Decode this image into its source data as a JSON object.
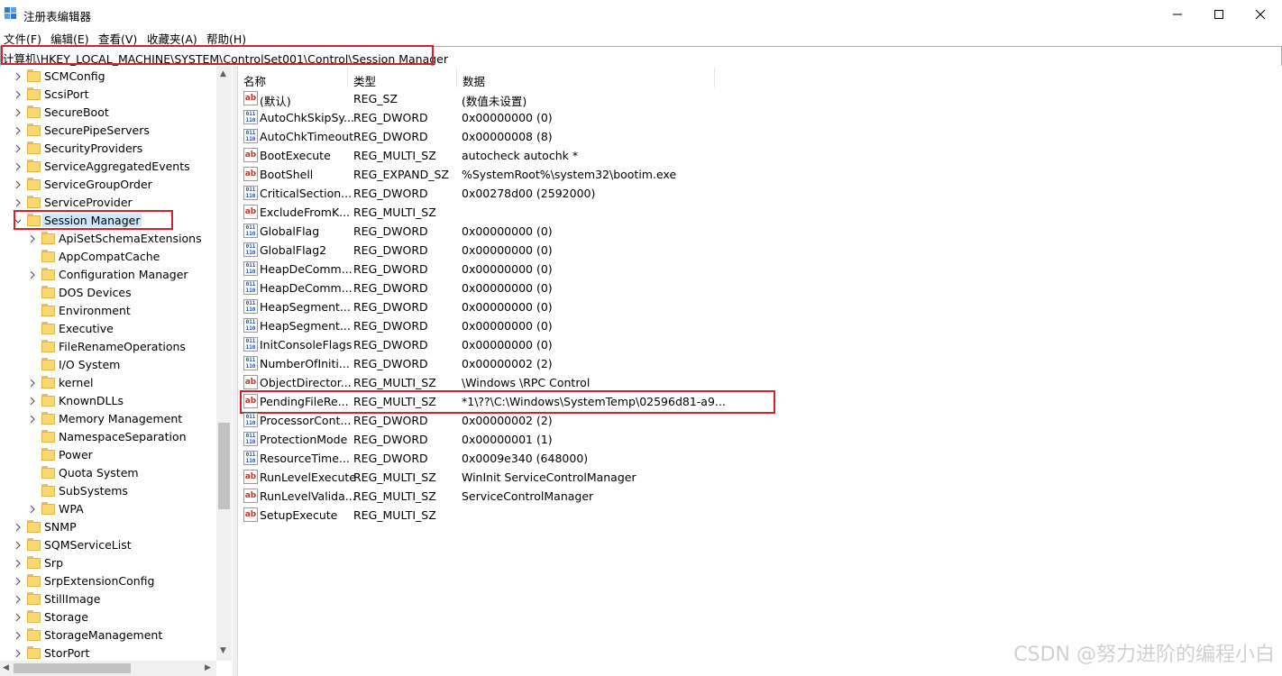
{
  "window": {
    "title": "注册表编辑器"
  },
  "menu": [
    "文件(F)",
    "编辑(E)",
    "查看(V)",
    "收藏夹(A)",
    "帮助(H)"
  ],
  "address": "计算机\\HKEY_LOCAL_MACHINE\\SYSTEM\\ControlSet001\\Control\\Session Manager",
  "tree": [
    {
      "label": "SCMConfig",
      "level": 0,
      "expandable": true
    },
    {
      "label": "ScsiPort",
      "level": 0,
      "expandable": true
    },
    {
      "label": "SecureBoot",
      "level": 0,
      "expandable": true
    },
    {
      "label": "SecurePipeServers",
      "level": 0,
      "expandable": true
    },
    {
      "label": "SecurityProviders",
      "level": 0,
      "expandable": true
    },
    {
      "label": "ServiceAggregatedEvents",
      "level": 0,
      "expandable": true
    },
    {
      "label": "ServiceGroupOrder",
      "level": 0,
      "expandable": true
    },
    {
      "label": "ServiceProvider",
      "level": 0,
      "expandable": true
    },
    {
      "label": "Session Manager",
      "level": 0,
      "expandable": true,
      "expanded": true,
      "selected": true
    },
    {
      "label": "ApiSetSchemaExtensions",
      "level": 1,
      "expandable": true
    },
    {
      "label": "AppCompatCache",
      "level": 1,
      "expandable": false
    },
    {
      "label": "Configuration Manager",
      "level": 1,
      "expandable": true
    },
    {
      "label": "DOS Devices",
      "level": 1,
      "expandable": false
    },
    {
      "label": "Environment",
      "level": 1,
      "expandable": false
    },
    {
      "label": "Executive",
      "level": 1,
      "expandable": false
    },
    {
      "label": "FileRenameOperations",
      "level": 1,
      "expandable": false
    },
    {
      "label": "I/O System",
      "level": 1,
      "expandable": false
    },
    {
      "label": "kernel",
      "level": 1,
      "expandable": true
    },
    {
      "label": "KnownDLLs",
      "level": 1,
      "expandable": true
    },
    {
      "label": "Memory Management",
      "level": 1,
      "expandable": true
    },
    {
      "label": "NamespaceSeparation",
      "level": 1,
      "expandable": false
    },
    {
      "label": "Power",
      "level": 1,
      "expandable": false
    },
    {
      "label": "Quota System",
      "level": 1,
      "expandable": false
    },
    {
      "label": "SubSystems",
      "level": 1,
      "expandable": false
    },
    {
      "label": "WPA",
      "level": 1,
      "expandable": true
    },
    {
      "label": "SNMP",
      "level": 0,
      "expandable": true
    },
    {
      "label": "SQMServiceList",
      "level": 0,
      "expandable": true
    },
    {
      "label": "Srp",
      "level": 0,
      "expandable": true
    },
    {
      "label": "SrpExtensionConfig",
      "level": 0,
      "expandable": true
    },
    {
      "label": "StillImage",
      "level": 0,
      "expandable": true
    },
    {
      "label": "Storage",
      "level": 0,
      "expandable": true
    },
    {
      "label": "StorageManagement",
      "level": 0,
      "expandable": true
    },
    {
      "label": "StorPort",
      "level": 0,
      "expandable": true
    }
  ],
  "columns": {
    "name": "名称",
    "type": "类型",
    "data": "数据"
  },
  "values": [
    {
      "icon": "ab",
      "name": "(默认)",
      "type": "REG_SZ",
      "data": "(数值未设置)"
    },
    {
      "icon": "bin",
      "name": "AutoChkSkipSy...",
      "type": "REG_DWORD",
      "data": "0x00000000 (0)"
    },
    {
      "icon": "bin",
      "name": "AutoChkTimeout",
      "type": "REG_DWORD",
      "data": "0x00000008 (8)"
    },
    {
      "icon": "ab",
      "name": "BootExecute",
      "type": "REG_MULTI_SZ",
      "data": "autocheck autochk *"
    },
    {
      "icon": "ab",
      "name": "BootShell",
      "type": "REG_EXPAND_SZ",
      "data": "%SystemRoot%\\system32\\bootim.exe"
    },
    {
      "icon": "bin",
      "name": "CriticalSection...",
      "type": "REG_DWORD",
      "data": "0x00278d00 (2592000)"
    },
    {
      "icon": "ab",
      "name": "ExcludeFromK...",
      "type": "REG_MULTI_SZ",
      "data": ""
    },
    {
      "icon": "bin",
      "name": "GlobalFlag",
      "type": "REG_DWORD",
      "data": "0x00000000 (0)"
    },
    {
      "icon": "bin",
      "name": "GlobalFlag2",
      "type": "REG_DWORD",
      "data": "0x00000000 (0)"
    },
    {
      "icon": "bin",
      "name": "HeapDeComm...",
      "type": "REG_DWORD",
      "data": "0x00000000 (0)"
    },
    {
      "icon": "bin",
      "name": "HeapDeComm...",
      "type": "REG_DWORD",
      "data": "0x00000000 (0)"
    },
    {
      "icon": "bin",
      "name": "HeapSegment...",
      "type": "REG_DWORD",
      "data": "0x00000000 (0)"
    },
    {
      "icon": "bin",
      "name": "HeapSegment...",
      "type": "REG_DWORD",
      "data": "0x00000000 (0)"
    },
    {
      "icon": "bin",
      "name": "InitConsoleFlags",
      "type": "REG_DWORD",
      "data": "0x00000000 (0)"
    },
    {
      "icon": "bin",
      "name": "NumberOfIniti...",
      "type": "REG_DWORD",
      "data": "0x00000002 (2)"
    },
    {
      "icon": "ab",
      "name": "ObjectDirector...",
      "type": "REG_MULTI_SZ",
      "data": "\\Windows \\RPC Control"
    },
    {
      "icon": "ab",
      "name": "PendingFileRe...",
      "type": "REG_MULTI_SZ",
      "data": "*1\\??\\C:\\Windows\\SystemTemp\\02596d81-a9...",
      "highlighted": true
    },
    {
      "icon": "bin",
      "name": "ProcessorCont...",
      "type": "REG_DWORD",
      "data": "0x00000002 (2)"
    },
    {
      "icon": "bin",
      "name": "ProtectionMode",
      "type": "REG_DWORD",
      "data": "0x00000001 (1)"
    },
    {
      "icon": "bin",
      "name": "ResourceTime...",
      "type": "REG_DWORD",
      "data": "0x0009e340 (648000)"
    },
    {
      "icon": "ab",
      "name": "RunLevelExecute",
      "type": "REG_MULTI_SZ",
      "data": "WinInit ServiceControlManager"
    },
    {
      "icon": "ab",
      "name": "RunLevelValida...",
      "type": "REG_MULTI_SZ",
      "data": "ServiceControlManager"
    },
    {
      "icon": "ab",
      "name": "SetupExecute",
      "type": "REG_MULTI_SZ",
      "data": ""
    }
  ],
  "watermark": "CSDN @努力进阶的编程小白",
  "colors": {
    "highlight_box": "#d2222d",
    "selection": "#cce8ff",
    "folder": "#fcd770"
  }
}
